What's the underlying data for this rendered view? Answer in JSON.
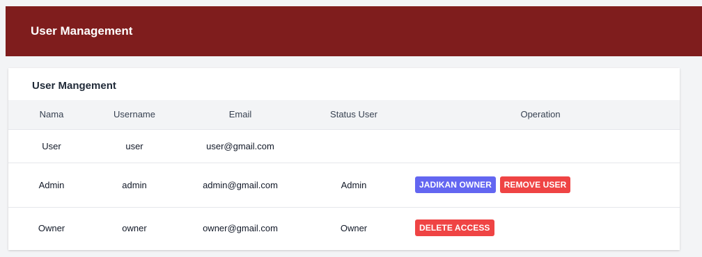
{
  "header": {
    "title": "User Management"
  },
  "card": {
    "title": "User Mangement"
  },
  "table": {
    "columns": [
      "Nama",
      "Username",
      "Email",
      "Status User",
      "Operation"
    ],
    "rows": [
      {
        "nama": "User",
        "username": "user",
        "email": "user@gmail.com",
        "status": "",
        "operations": []
      },
      {
        "nama": "Admin",
        "username": "admin",
        "email": "admin@gmail.com",
        "status": "Admin",
        "operations": [
          "JADIKAN OWNER",
          "REMOVE USER"
        ]
      },
      {
        "nama": "Owner",
        "username": "owner",
        "email": "owner@gmail.com",
        "status": "Owner",
        "operations": [
          "DELETE ACCESS"
        ]
      }
    ]
  },
  "colors": {
    "header_bg": "#7f1d1d",
    "primary_button": "#6366f1",
    "danger_button": "#ef4444"
  }
}
